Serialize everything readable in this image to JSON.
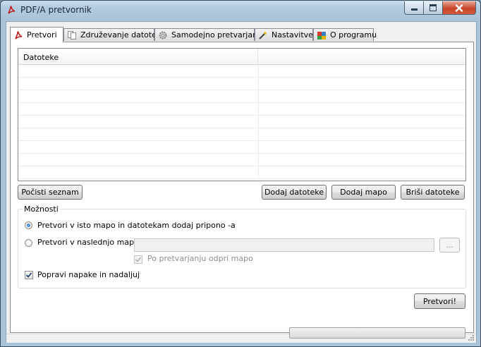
{
  "window": {
    "title": "PDF/A pretvornik"
  },
  "tabs": [
    {
      "label": "Pretvori",
      "icon": "pdf-icon",
      "active": true
    },
    {
      "label": "Združevanje datotek",
      "icon": "documents-icon",
      "active": false
    },
    {
      "label": "Samodejno pretvarjanje",
      "icon": "gear-icon",
      "active": false
    },
    {
      "label": "Nastavitve",
      "icon": "wand-icon",
      "active": false
    },
    {
      "label": "O programu",
      "icon": "info-cube-icon",
      "active": false
    }
  ],
  "file_list": {
    "columns": [
      "Datoteke",
      ""
    ],
    "rows": []
  },
  "buttons": {
    "clear_list": "Počisti seznam",
    "add_files": "Dodaj datoteke",
    "add_folder": "Dodaj mapo",
    "delete_files": "Briši datoteke",
    "convert": "Pretvori!",
    "browse": "..."
  },
  "options": {
    "title": "Možnosti",
    "radio_same_folder": {
      "label": "Pretvori v isto mapo in datotekam dodaj pripono -a",
      "selected": true
    },
    "radio_next_folder": {
      "label": "Pretvori v naslednjo mapo:",
      "selected": false
    },
    "folder_path": "",
    "open_folder_after": {
      "label": "Po pretvarjanju odpri mapo",
      "checked": true,
      "enabled": false
    },
    "fix_errors": {
      "label": "Popravi napake in nadaljuj",
      "checked": true
    }
  },
  "status": {
    "progress": 0
  },
  "colors": {
    "accent": "#3c7fb1",
    "radio_dot": "#1a5ab8",
    "close_button": "#c7472b"
  }
}
